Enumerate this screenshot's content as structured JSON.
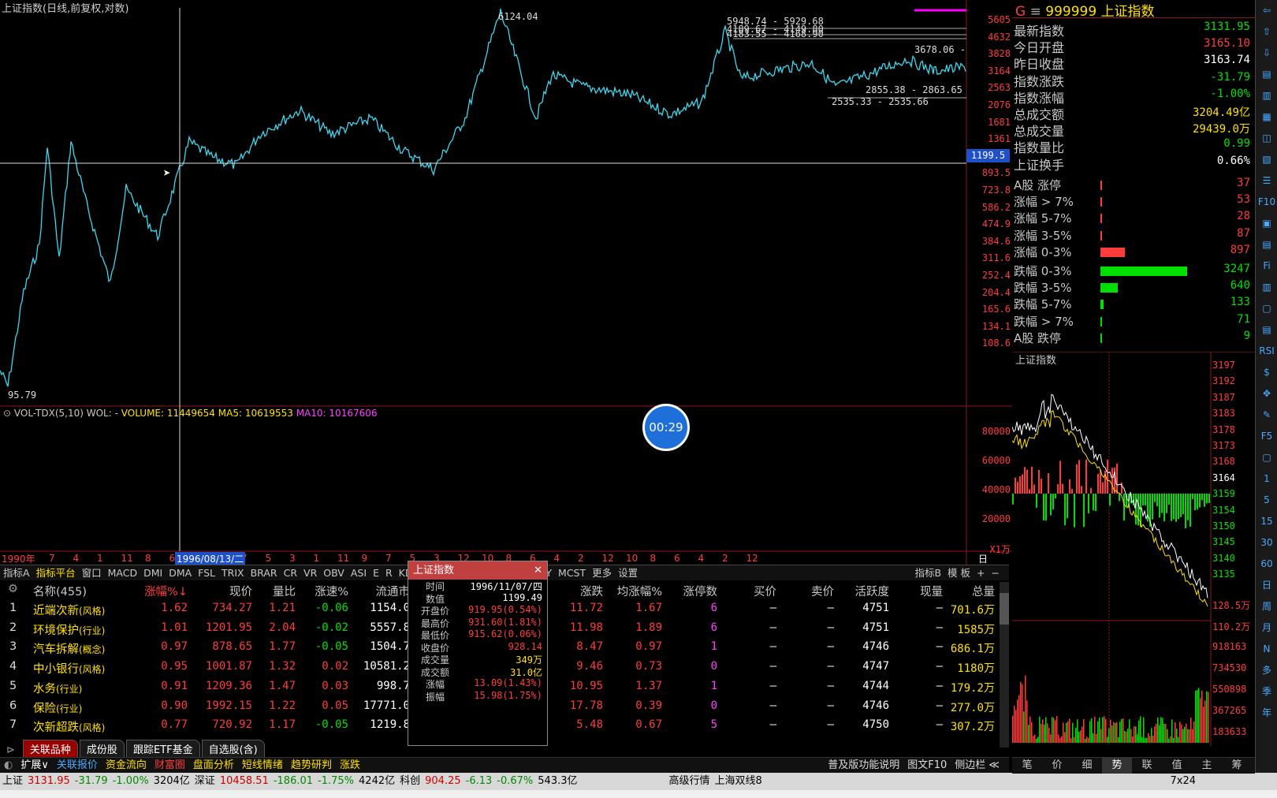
{
  "chart_title": "上证指数(日线,前复权,对数)",
  "price_axis": [
    "5605",
    "4632",
    "3828",
    "3164",
    "2563",
    "2076",
    "1681",
    "1361",
    "1103",
    "893.5",
    "723.8",
    "586.2",
    "474.9",
    "384.6",
    "311.6",
    "252.4",
    "204.4",
    "165.6",
    "134.1",
    "108.6"
  ],
  "crosshair_value": "1199.5",
  "annotations": {
    "high": "6124.04",
    "low": "95.79",
    "a1": "5948.74 - 5929.68",
    "a2": "4189.67 - 4149.80",
    "a3": "4183.55 - 4168.90",
    "a4": "3678.06 -",
    "a5": "2855.38 - 2863.65",
    "a6": "2535.33 - 2535.66"
  },
  "vol": {
    "title": "VOL-TDX(5,10)",
    "wol": "WOL: -",
    "volume": "VOLUME: 11449654",
    "ma5": "MA5: 10619553",
    "ma10": "MA10: 10167606",
    "axis": [
      "80000",
      "60000",
      "40000",
      "20000",
      "X1万"
    ]
  },
  "timer": "00:29",
  "date_axis": {
    "start": "1990年",
    "cursor": "1996/08/13/二",
    "end": "日线",
    "ticks": [
      "7",
      "4",
      "1",
      "11",
      "8",
      "6",
      "1",
      "9",
      "7",
      "5",
      "3",
      "1",
      "11",
      "9",
      "7",
      "5",
      "3",
      "12",
      "10",
      "8",
      "6",
      "4",
      "2",
      "12",
      "10",
      "8",
      "6",
      "4",
      "2",
      "12"
    ]
  },
  "indicator_tabs": [
    "指标A",
    "指标平台",
    "窗口",
    "MACD",
    "DMI",
    "DMA",
    "FSL",
    "TRIX",
    "BRAR",
    "CR",
    "VR",
    "OBV",
    "ASI",
    "E",
    "R",
    "KDJ",
    "CCI",
    "ROC",
    "MTM",
    "BOLL",
    "PSY",
    "MCST",
    "更多",
    "设置"
  ],
  "indicator_right": [
    "指标B",
    "模 板",
    "+",
    "−"
  ],
  "table": {
    "headers": [
      "名称(455)",
      "涨幅%↓",
      "现价",
      "量比",
      "涨速%",
      "流通市",
      "涨跌",
      "均涨幅%",
      "涨停数",
      "买价",
      "卖价",
      "活跃度",
      "现量",
      "总量"
    ],
    "rows": [
      {
        "no": "1",
        "name": "近端次新",
        "tag": "(风格)",
        "pct": "1.62",
        "price": "734.27",
        "lb": "1.21",
        "spd": "-0.06",
        "mv": "1154.0",
        "chg": "11.72",
        "avg": "1.67",
        "zt": "6",
        "buy": "–",
        "sell": "–",
        "act": "4751",
        "cur": "–",
        "vol": "701.6万"
      },
      {
        "no": "2",
        "name": "环境保护",
        "tag": "(行业)",
        "pct": "1.01",
        "price": "1201.95",
        "lb": "2.04",
        "spd": "-0.02",
        "mv": "5557.8",
        "chg": "11.98",
        "avg": "1.89",
        "zt": "6",
        "buy": "–",
        "sell": "–",
        "act": "4751",
        "cur": "–",
        "vol": "1585万"
      },
      {
        "no": "3",
        "name": "汽车拆解",
        "tag": "(概念)",
        "pct": "0.97",
        "price": "878.65",
        "lb": "1.77",
        "spd": "-0.05",
        "mv": "1504.7",
        "chg": "8.47",
        "avg": "0.97",
        "zt": "1",
        "buy": "–",
        "sell": "–",
        "act": "4746",
        "cur": "–",
        "vol": "686.1万"
      },
      {
        "no": "4",
        "name": "中小银行",
        "tag": "(风格)",
        "pct": "0.95",
        "price": "1001.87",
        "lb": "1.32",
        "spd": "0.02",
        "mv": "10581.2",
        "chg": "9.46",
        "avg": "0.73",
        "zt": "0",
        "buy": "–",
        "sell": "–",
        "act": "4747",
        "cur": "–",
        "vol": "1180万"
      },
      {
        "no": "5",
        "name": "水务",
        "tag": "(行业)",
        "pct": "0.91",
        "price": "1209.36",
        "lb": "1.47",
        "spd": "0.03",
        "mv": "998.7",
        "chg": "10.95",
        "avg": "1.37",
        "zt": "1",
        "buy": "–",
        "sell": "–",
        "act": "4744",
        "cur": "–",
        "vol": "179.2万"
      },
      {
        "no": "6",
        "name": "保险",
        "tag": "(行业)",
        "pct": "0.90",
        "price": "1992.15",
        "lb": "1.22",
        "spd": "0.05",
        "mv": "17771.0",
        "chg": "17.78",
        "avg": "0.39",
        "zt": "0",
        "buy": "–",
        "sell": "–",
        "act": "4746",
        "cur": "–",
        "vol": "277.0万"
      },
      {
        "no": "7",
        "name": "次新超跌",
        "tag": "(风格)",
        "pct": "0.77",
        "price": "720.92",
        "lb": "1.17",
        "spd": "-0.05",
        "mv": "1219.8",
        "chg": "5.48",
        "avg": "0.67",
        "zt": "5",
        "buy": "–",
        "sell": "–",
        "act": "4750",
        "cur": "–",
        "vol": "307.2万"
      }
    ]
  },
  "popup": {
    "title": "上证指数",
    "rows": [
      {
        "k": "时间",
        "v": "1996/11/07/四"
      },
      {
        "k": "数值",
        "v": "1199.49"
      },
      {
        "k": "开盘价",
        "v": "919.95(0.54%)"
      },
      {
        "k": "最高价",
        "v": "931.60(1.81%)"
      },
      {
        "k": "最低价",
        "v": "915.62(0.06%)"
      },
      {
        "k": "收盘价",
        "v": "928.14"
      },
      {
        "k": "成交量",
        "v": "349万"
      },
      {
        "k": "成交额",
        "v": "31.0亿"
      },
      {
        "k": "涨幅",
        "v": "13.09(1.43%)"
      },
      {
        "k": "振幅",
        "v": "15.98(1.75%)"
      }
    ]
  },
  "bottom_tabs": [
    "关联品种",
    "成份股",
    "跟踪ETF基金",
    "自选股(含)"
  ],
  "toolbar": [
    "扩展∨",
    "关联报价",
    "资金流向",
    "财富圈",
    "盘面分析",
    "短线情绪",
    "趋势研判",
    "涨跌"
  ],
  "toolbar_right": [
    "普及版功能说明",
    "图文F10",
    "侧边栏 ≪"
  ],
  "status": {
    "sh_label": "上证",
    "sh_val": "3131.95",
    "sh_chg": "-31.79",
    "sh_pct": "-1.00%",
    "sh_amt": "3204亿",
    "sz_label": "深证",
    "sz_val": "10458.51",
    "sz_chg": "-186.01",
    "sz_pct": "-1.75%",
    "sz_amt": "4242亿",
    "kc_label": "科创",
    "kc_val": "904.25",
    "kc_chg": "-6.13",
    "kc_pct": "-0.67%",
    "kc_amt": "543.3亿",
    "hq": "高级行情",
    "line": "上海双线8",
    "clock": "7x24"
  },
  "quote": {
    "code": "999999",
    "name": "上证指数",
    "rows": [
      {
        "k": "最新指数",
        "v": "3131.95",
        "c": "green"
      },
      {
        "k": "今日开盘",
        "v": "3165.10",
        "c": "red"
      },
      {
        "k": "昨日收盘",
        "v": "3163.74",
        "c": "white"
      },
      {
        "k": "指数涨跌",
        "v": "-31.79",
        "c": "green"
      },
      {
        "k": "指数涨幅",
        "v": "-1.00%",
        "c": "green"
      },
      {
        "k": "总成交额",
        "v": "3204.49亿",
        "c": "yellow"
      },
      {
        "k": "总成交量",
        "v": "29439.0万",
        "c": "yellow"
      },
      {
        "k": "指数量比",
        "v": "0.99",
        "c": "green"
      },
      {
        "k": "上证换手",
        "v": "0.66%",
        "c": "white"
      }
    ]
  },
  "breadth": [
    {
      "k": "A股 涨停",
      "v": "37",
      "c": "red",
      "w": 0.005
    },
    {
      "k": "涨幅 > 7%",
      "v": "53",
      "c": "red",
      "w": 0.005
    },
    {
      "k": "涨幅 5-7%",
      "v": "28",
      "c": "red",
      "w": 0.005
    },
    {
      "k": "涨幅 3-5%",
      "v": "87",
      "c": "red",
      "w": 0.02
    },
    {
      "k": "涨幅 0-3%",
      "v": "897",
      "c": "red",
      "w": 0.28
    },
    {
      "k": "跌幅 0-3%",
      "v": "3247",
      "c": "green",
      "w": 1.0
    },
    {
      "k": "跌幅 3-5%",
      "v": "640",
      "c": "green",
      "w": 0.2
    },
    {
      "k": "跌幅 5-7%",
      "v": "133",
      "c": "green",
      "w": 0.04
    },
    {
      "k": "跌幅 > 7%",
      "v": "71",
      "c": "green",
      "w": 0.02
    },
    {
      "k": "A股 跌停",
      "v": "9",
      "c": "green",
      "w": 0.005
    }
  ],
  "mini": {
    "title": "上证指数",
    "axis": [
      "3197",
      "3192",
      "3187",
      "3183",
      "3178",
      "3173",
      "3168",
      "3164",
      "3159",
      "3154",
      "3150",
      "3145",
      "3140",
      "3135",
      "128.5万",
      "110.2万",
      "918163",
      "734530",
      "550898",
      "367265",
      "183633"
    ]
  },
  "right_bottom_tabs": [
    "笔",
    "价",
    "细",
    "势",
    "联",
    "值",
    "主",
    "筹"
  ],
  "rtool": [
    "⇦",
    "⇧",
    "⇩",
    "▤",
    "▥",
    "▦",
    "◫",
    "▧",
    "☰",
    "F10",
    "▣",
    "▤",
    "Fi",
    "▥",
    "▢",
    "▤",
    "RSI",
    "$",
    "✥",
    "✎",
    "F5",
    "▢",
    "1",
    "5",
    "15",
    "30",
    "60",
    "日",
    "周",
    "月",
    "N",
    "多",
    "季",
    "年"
  ]
}
